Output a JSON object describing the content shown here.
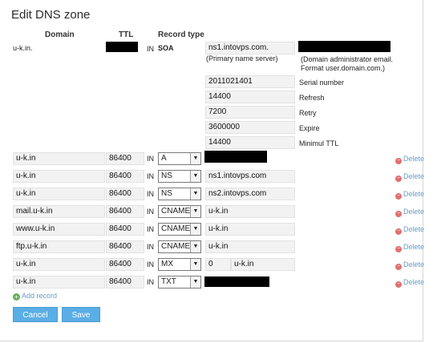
{
  "title": "Edit DNS zone",
  "headers": {
    "domain": "Domain",
    "ttl": "TTL",
    "record_type": "Record type"
  },
  "soa": {
    "domain": "u-k.in.",
    "in": "IN",
    "type": "SOA",
    "primary_ns": "ns1.intovps.com.",
    "primary_ns_hint": "(Primary name server)",
    "admin_email_hint_line1": "(Domain administrator email.",
    "admin_email_hint_line2": "Format user.domain.com.)",
    "serial": "2011021401",
    "serial_label": "Serial number",
    "refresh": "14400",
    "refresh_label": "Refresh",
    "retry": "7200",
    "retry_label": "Retry",
    "expire": "3600000",
    "expire_label": "Expire",
    "min_ttl": "14400",
    "min_ttl_label": "Minimul TTL"
  },
  "records": [
    {
      "domain": "u-k.in",
      "ttl": "86400",
      "in": "IN",
      "type": "A",
      "value": "",
      "value2": "",
      "delete": "Delete"
    },
    {
      "domain": "u-k.in",
      "ttl": "86400",
      "in": "IN",
      "type": "NS",
      "value": "ns1.intovps.com",
      "value2": "",
      "delete": "Delete"
    },
    {
      "domain": "u-k.in",
      "ttl": "86400",
      "in": "IN",
      "type": "NS",
      "value": "ns2.intovps.com",
      "value2": "",
      "delete": "Delete"
    },
    {
      "domain": "mail.u-k.in",
      "ttl": "86400",
      "in": "IN",
      "type": "CNAME",
      "value": "u-k.in",
      "value2": "",
      "delete": "Delete"
    },
    {
      "domain": "www.u-k.in",
      "ttl": "86400",
      "in": "IN",
      "type": "CNAME",
      "value": "u-k.in",
      "value2": "",
      "delete": "Delete"
    },
    {
      "domain": "ftp.u-k.in",
      "ttl": "86400",
      "in": "IN",
      "type": "CNAME",
      "value": "u-k.in",
      "value2": "",
      "delete": "Delete"
    },
    {
      "domain": "u-k.in",
      "ttl": "86400",
      "in": "IN",
      "type": "MX",
      "value": "0",
      "value2": "u-k.in",
      "delete": "Delete"
    },
    {
      "domain": "u-k.in",
      "ttl": "86400",
      "in": "IN",
      "type": "TXT",
      "value": "",
      "value2": "",
      "delete": "Delete"
    }
  ],
  "add_record": "Add record",
  "buttons": {
    "cancel": "Cancel",
    "save": "Save"
  },
  "icons": {
    "delete": "delete-circle-icon",
    "add": "add-circle-icon",
    "dropdown": "chevron-down-icon"
  },
  "colors": {
    "button": "#5aaee6",
    "link": "#6a9bc7",
    "delete_icon": "#e07070",
    "add_icon": "#64b05a",
    "redaction": "#000000"
  }
}
